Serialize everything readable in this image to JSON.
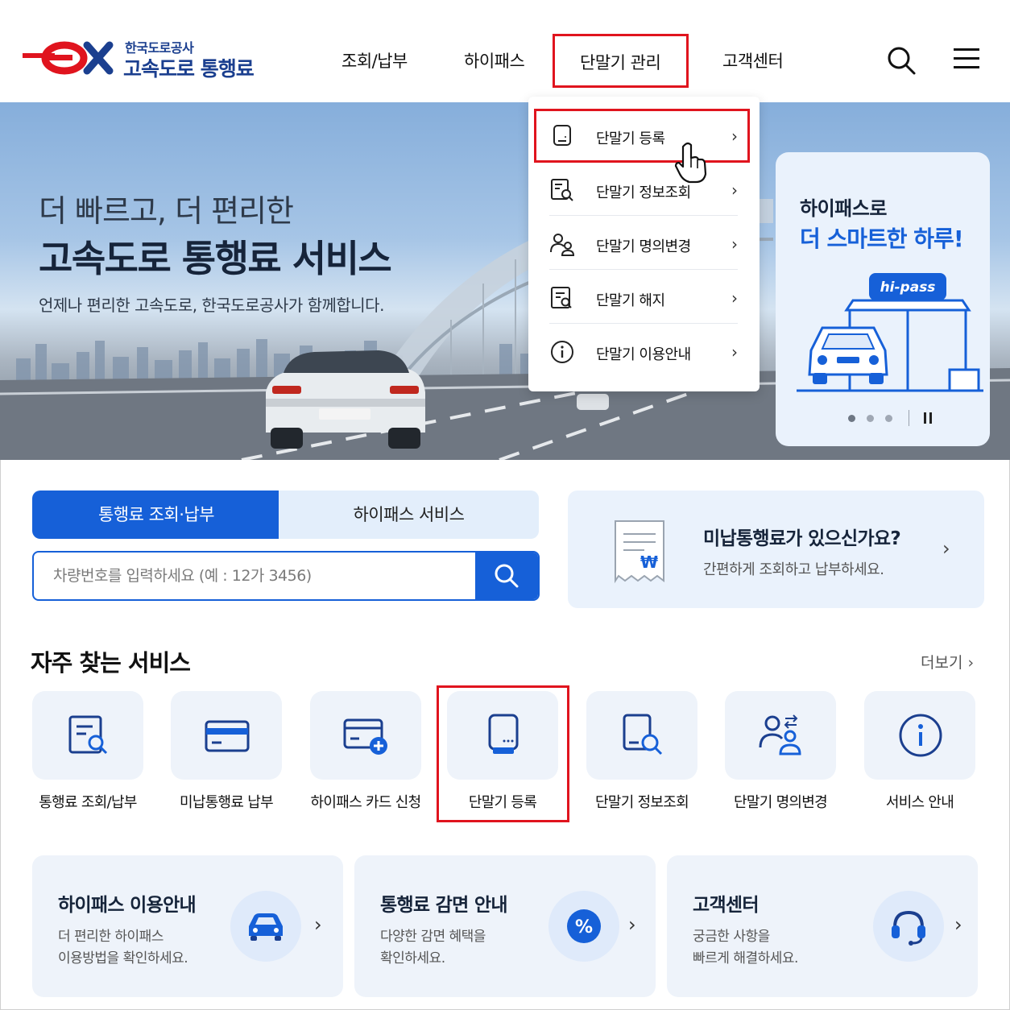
{
  "header": {
    "logo_sub": "한국도로공사",
    "logo_main": "고속도로 통행료",
    "nav": [
      "조회/납부",
      "하이패스",
      "단말기 관리",
      "고객센터"
    ]
  },
  "dropdown": {
    "items": [
      {
        "label": "단말기 등록",
        "icon": "device-icon"
      },
      {
        "label": "단말기 정보조회",
        "icon": "device-search-icon"
      },
      {
        "label": "단말기 명의변경",
        "icon": "users-icon"
      },
      {
        "label": "단말기 해지",
        "icon": "document-search-icon"
      },
      {
        "label": "단말기 이용안내",
        "icon": "info-icon"
      }
    ]
  },
  "hero": {
    "line1": "더 빠르고, 더 편리한",
    "line2": "고속도로 통행료 서비스",
    "line3": "언제나 편리한 고속도로, 한국도로공사가 함께합니다.",
    "promo_line1": "하이패스로",
    "promo_line2": "더 스마트한 하루!",
    "promo_badge": "hi-pass"
  },
  "search": {
    "tabs": [
      "통행료 조회·납부",
      "하이패스 서비스"
    ],
    "placeholder": "차량번호를 입력하세요 (예 : 12가 3456)"
  },
  "unpaid": {
    "title": "미납통행료가 있으신가요?",
    "subtitle": "간편하게 조회하고 납부하세요."
  },
  "frequent": {
    "title": "자주 찾는 서비스",
    "more": "더보기",
    "items": [
      {
        "label": "통행료 조회/납부",
        "icon": "document-search-icon"
      },
      {
        "label": "미납통행료 납부",
        "icon": "card-icon"
      },
      {
        "label": "하이패스 카드 신청",
        "icon": "card-add-icon"
      },
      {
        "label": "단말기 등록",
        "icon": "device-icon"
      },
      {
        "label": "단말기 정보조회",
        "icon": "device-search-icon"
      },
      {
        "label": "단말기 명의변경",
        "icon": "users-transfer-icon"
      },
      {
        "label": "서비스 안내",
        "icon": "info-icon"
      }
    ]
  },
  "cards": [
    {
      "title": "하이패스 이용안내",
      "desc1": "더 편리한 하이패스",
      "desc2": "이용방법을 확인하세요.",
      "icon": "car-icon"
    },
    {
      "title": "통행료 감면 안내",
      "desc1": "다양한 감면 혜택을",
      "desc2": "확인하세요.",
      "icon": "percent-icon"
    },
    {
      "title": "고객센터",
      "desc1": "궁금한 사항을",
      "desc2": "빠르게 해결하세요.",
      "icon": "headset-icon"
    }
  ],
  "colors": {
    "brand": "#1660d8",
    "logo_red": "#e0141e",
    "logo_navy": "#1b3f8f",
    "highlight": "#e0141e"
  }
}
